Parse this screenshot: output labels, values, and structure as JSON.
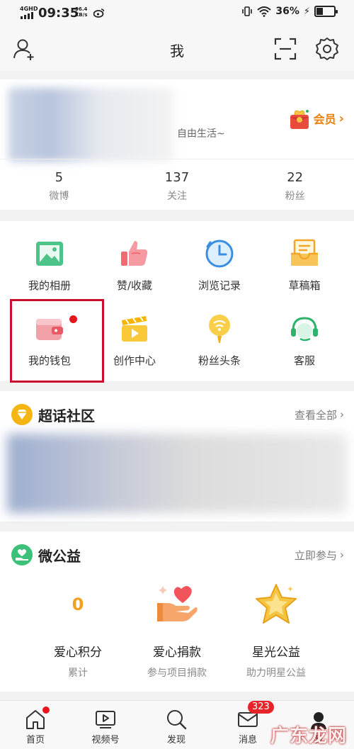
{
  "status_bar": {
    "network": "4GHD",
    "time": "09:35",
    "speed_value": "96.4",
    "speed_unit": "KB/s",
    "battery": "36%",
    "battery_level": 0.36
  },
  "header": {
    "title": "我",
    "icons": [
      "add-friend-icon",
      "scan-icon",
      "settings-icon"
    ]
  },
  "profile": {
    "bio_visible": "自由生活~",
    "vip_label": "会员",
    "vip_arrow": "›"
  },
  "stats": [
    {
      "value": "5",
      "label": "微博"
    },
    {
      "value": "137",
      "label": "关注"
    },
    {
      "value": "22",
      "label": "粉丝"
    }
  ],
  "grid": [
    {
      "label": "我的相册",
      "icon": "album-icon"
    },
    {
      "label": "赞/收藏",
      "icon": "thumbs-up-icon"
    },
    {
      "label": "浏览记录",
      "icon": "clock-icon"
    },
    {
      "label": "草稿箱",
      "icon": "draft-box-icon"
    },
    {
      "label": "我的钱包",
      "icon": "wallet-icon"
    },
    {
      "label": "创作中心",
      "icon": "clapperboard-icon"
    },
    {
      "label": "粉丝头条",
      "icon": "balloon-icon"
    },
    {
      "label": "客服",
      "icon": "headset-icon"
    }
  ],
  "super_topic": {
    "title": "超话社区",
    "more": "查看全部",
    "arrow": "›"
  },
  "charity": {
    "title": "微公益",
    "more": "立即参与",
    "arrow": "›",
    "items": [
      {
        "value": "0",
        "title": "爱心积分",
        "sub": "累计"
      },
      {
        "title": "爱心捐款",
        "sub": "参与项目捐款"
      },
      {
        "title": "星光公益",
        "sub": "助力明星公益"
      }
    ]
  },
  "bottom_nav": [
    {
      "label": "首页"
    },
    {
      "label": "视频号"
    },
    {
      "label": "发现"
    },
    {
      "label": "消息",
      "badge": "323"
    },
    {
      "label": "我"
    }
  ],
  "watermark": "广东龙网",
  "colors": {
    "accent_orange": "#e8800a",
    "badge_red": "#e3161c",
    "highlight_box": "#c8102e"
  }
}
